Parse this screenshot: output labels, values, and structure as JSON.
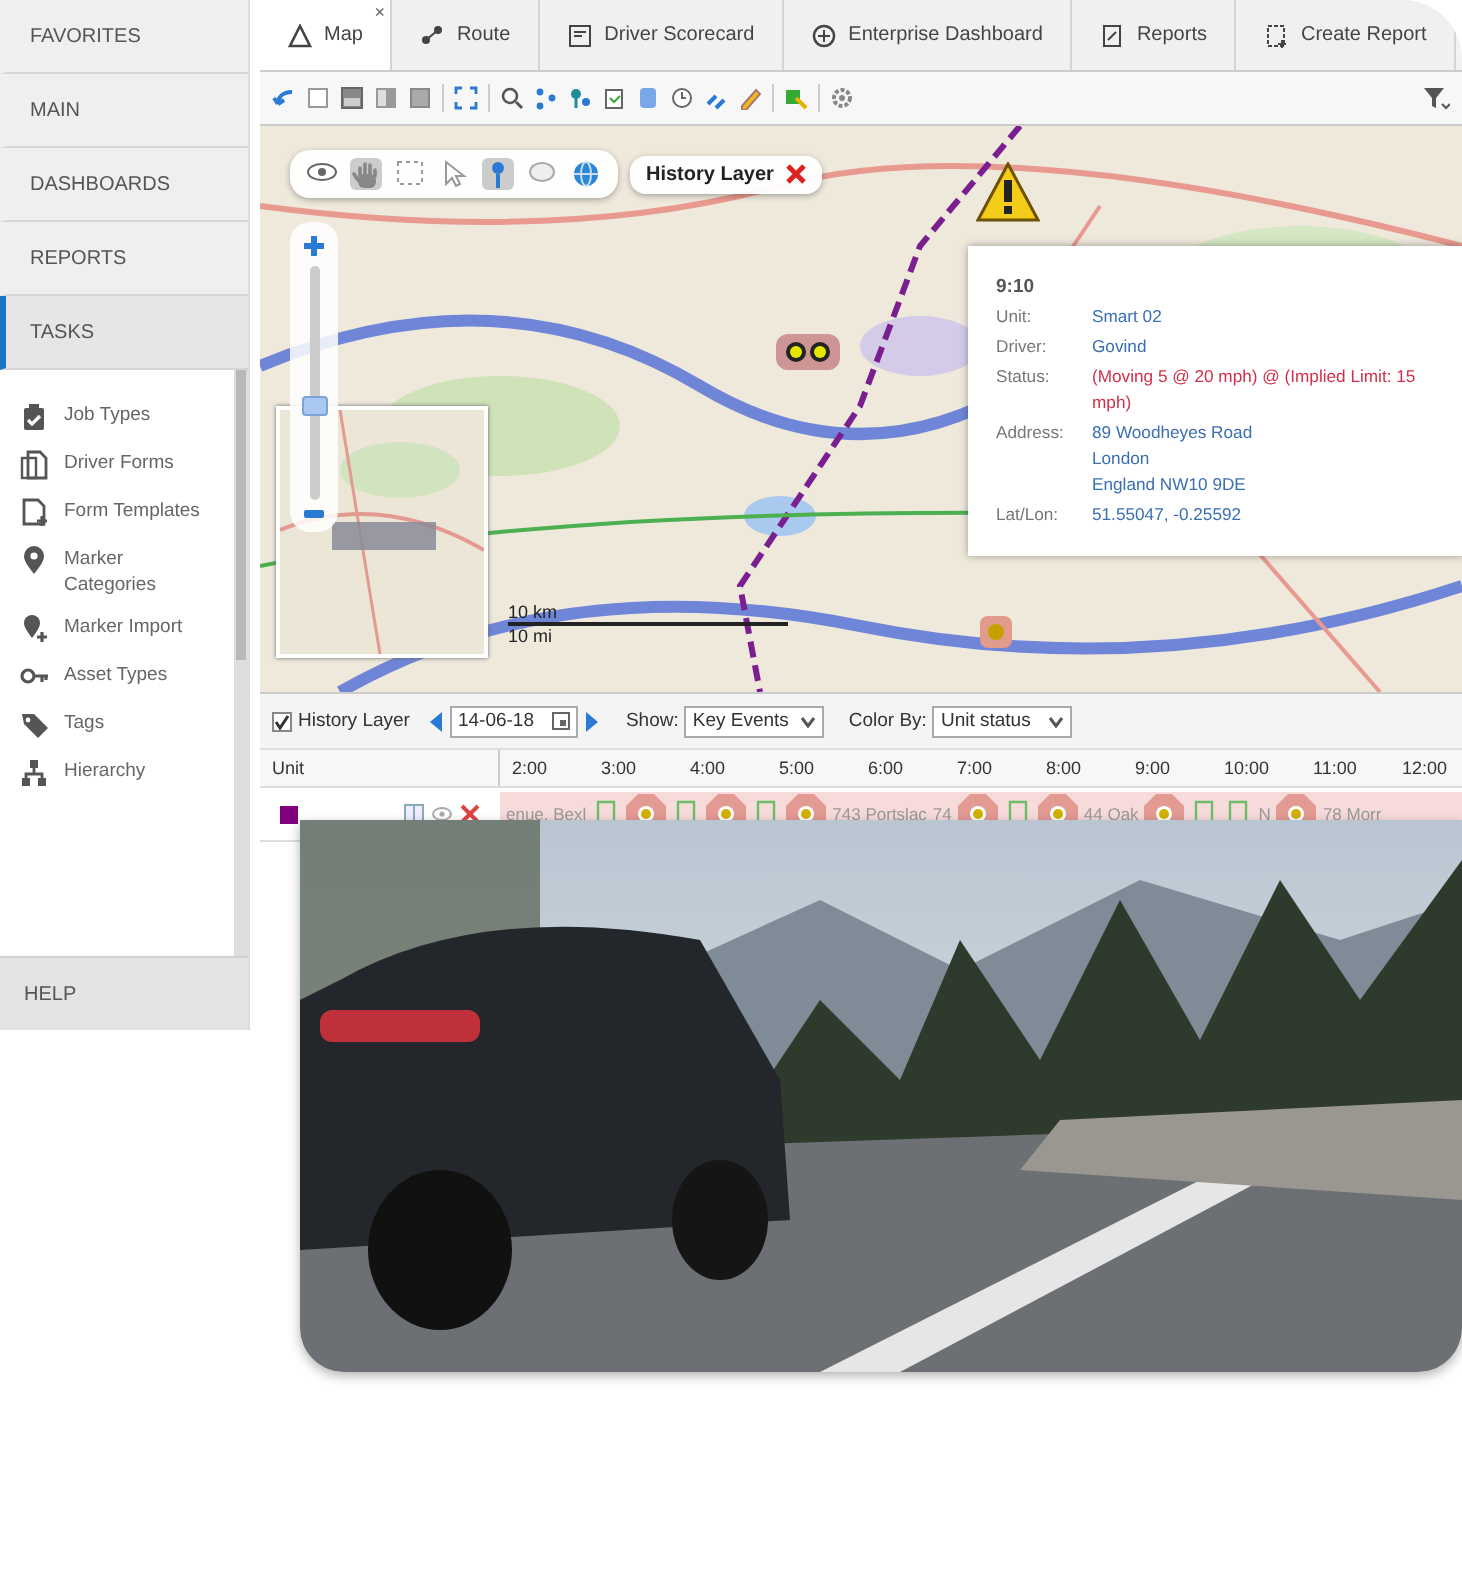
{
  "sidebar": {
    "sections": [
      {
        "label": "FAVORITES",
        "selected": false
      },
      {
        "label": "MAIN",
        "selected": false
      },
      {
        "label": "DASHBOARDS",
        "selected": false
      },
      {
        "label": "REPORTS",
        "selected": false
      },
      {
        "label": "TASKS",
        "selected": true
      }
    ],
    "items": [
      {
        "label": "Job Types"
      },
      {
        "label": "Driver Forms"
      },
      {
        "label": "Form Templates"
      },
      {
        "label": "Marker Categories"
      },
      {
        "label": "Marker Import"
      },
      {
        "label": "Asset Types"
      },
      {
        "label": "Tags"
      },
      {
        "label": "Hierarchy"
      }
    ],
    "footer_section": {
      "label": "HELP"
    }
  },
  "tabs": [
    {
      "label": "Map",
      "selected": true,
      "close": "×"
    },
    {
      "label": "Route",
      "selected": false
    },
    {
      "label": "Driver Scorecard",
      "selected": false
    },
    {
      "label": "Enterprise Dashboard",
      "selected": false
    },
    {
      "label": "Reports",
      "selected": false
    },
    {
      "label": "Create Report",
      "selected": false
    }
  ],
  "map": {
    "layer_toolbar": {
      "label": "History Layer"
    },
    "zoom": {
      "level": 0.4
    },
    "scale": {
      "km": "10 km",
      "mi": "10 mi"
    },
    "popup": {
      "time": "9:10",
      "fields": [
        {
          "label": "Unit:",
          "kind": "normal",
          "lines": [
            "Smart 02"
          ]
        },
        {
          "label": "Driver:",
          "kind": "normal",
          "lines": [
            "Govind"
          ]
        },
        {
          "label": "Status:",
          "kind": "alert",
          "lines": [
            "(Moving 5 @ 20 mph) @ (Implied Limit: 15 mph)"
          ]
        },
        {
          "label": "Address:",
          "kind": "normal",
          "lines": [
            "89 Woodheyes Road",
            "London",
            "England NW10 9DE"
          ]
        },
        {
          "label": "Lat/Lon:",
          "kind": "normal",
          "lines": [
            "51.55047, -0.25592"
          ]
        }
      ]
    }
  },
  "history_bar": {
    "layer_checkbox": {
      "label": "History Layer",
      "checked": true
    },
    "date": "14-06-18",
    "show": {
      "label": "Show:",
      "value": "Key Events"
    },
    "color_by": {
      "label": "Color By:",
      "value": "Unit status"
    }
  },
  "timeline": {
    "unit_column": "Unit",
    "hours": [
      "2:00",
      "3:00",
      "4:00",
      "5:00",
      "6:00",
      "7:00",
      "8:00",
      "9:00",
      "10:00",
      "11:00",
      "12:00"
    ],
    "rows": [
      {
        "color": "#800080",
        "events": [
          {
            "kind": "label",
            "text": "enue, Bexl"
          },
          {
            "kind": "trip"
          },
          {
            "kind": "stop"
          },
          {
            "kind": "trip"
          },
          {
            "kind": "stop"
          },
          {
            "kind": "trip"
          },
          {
            "kind": "stop"
          },
          {
            "kind": "label",
            "text": "743 Portslac"
          },
          {
            "kind": "label",
            "text": "74"
          },
          {
            "kind": "stop"
          },
          {
            "kind": "trip"
          },
          {
            "kind": "stop"
          },
          {
            "kind": "label",
            "text": "44 Oak"
          },
          {
            "kind": "stop"
          },
          {
            "kind": "trip"
          },
          {
            "kind": "trip"
          },
          {
            "kind": "label",
            "text": "N"
          },
          {
            "kind": "stop"
          },
          {
            "kind": "label",
            "text": "78 Morr"
          }
        ]
      }
    ]
  }
}
